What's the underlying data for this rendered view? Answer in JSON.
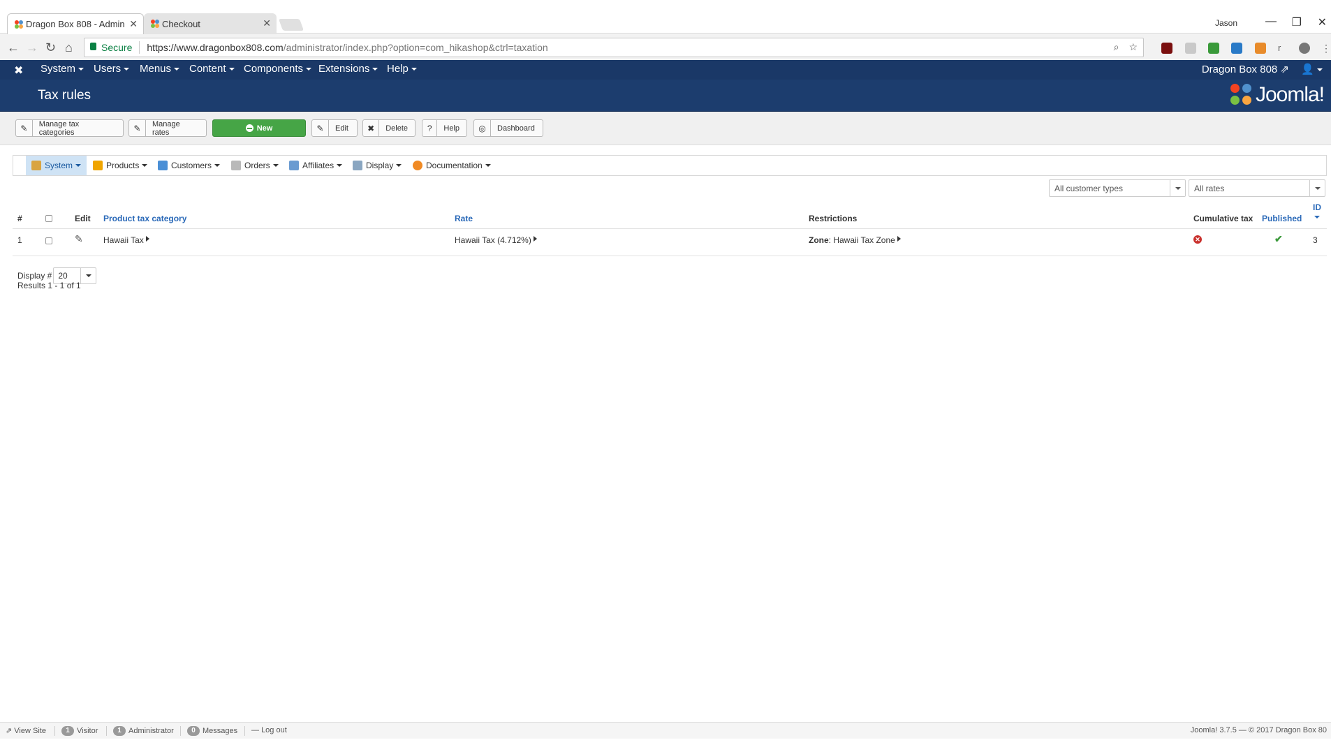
{
  "browser": {
    "tabs": [
      {
        "title": "Dragon Box 808 - Admin"
      },
      {
        "title": "Checkout"
      }
    ],
    "window_user": "Jason",
    "secure_label": "Secure",
    "url_host": "https://www.dragonbox808.com",
    "url_path": "/administrator/index.php?option=com_hikashop&ctrl=taxation"
  },
  "topnav": {
    "menus": [
      "System",
      "Users",
      "Menus",
      "Content",
      "Components",
      "Extensions",
      "Help"
    ],
    "site_name": "Dragon Box 808"
  },
  "header": {
    "title": "Tax rules",
    "brand": "Joomla!"
  },
  "toolbar": {
    "manage_tax_categories": "Manage tax categories",
    "manage_rates": "Manage rates",
    "new": "New",
    "edit": "Edit",
    "delete": "Delete",
    "help": "Help",
    "dashboard": "Dashboard"
  },
  "submenu": [
    "System",
    "Products",
    "Customers",
    "Orders",
    "Affiliates",
    "Display",
    "Documentation"
  ],
  "filters": {
    "customer_type": "All customer types",
    "rates": "All rates"
  },
  "table": {
    "headers": {
      "num": "#",
      "edit": "Edit",
      "category": "Product tax category",
      "rate": "Rate",
      "restrictions": "Restrictions",
      "cumulative": "Cumulative tax",
      "published": "Published",
      "id": "ID"
    },
    "rows": [
      {
        "num": "1",
        "category": "Hawaii Tax",
        "rate": "Hawaii Tax (4.712%)",
        "restriction_label": "Zone",
        "restriction_value": ": Hawaii Tax Zone",
        "cumulative": "no",
        "published": "yes",
        "id": "3"
      }
    ]
  },
  "pagination": {
    "display_label": "Display #",
    "display_value": "20",
    "results": "Results 1 - 1 of 1"
  },
  "statusbar": {
    "view_site": "View Site",
    "visitors_count": "1",
    "visitors_label": "Visitor",
    "admins_count": "1",
    "admins_label": "Administrator",
    "messages_count": "0",
    "messages_label": "Messages",
    "logout": "Log out",
    "copyright": "Joomla! 3.7.5 — © 2017 Dragon Box 80"
  },
  "colors": {
    "nav_bg": "#1a3867",
    "header_bg": "#1c3d6e",
    "new_button": "#46a546",
    "link": "#2a69b8"
  }
}
